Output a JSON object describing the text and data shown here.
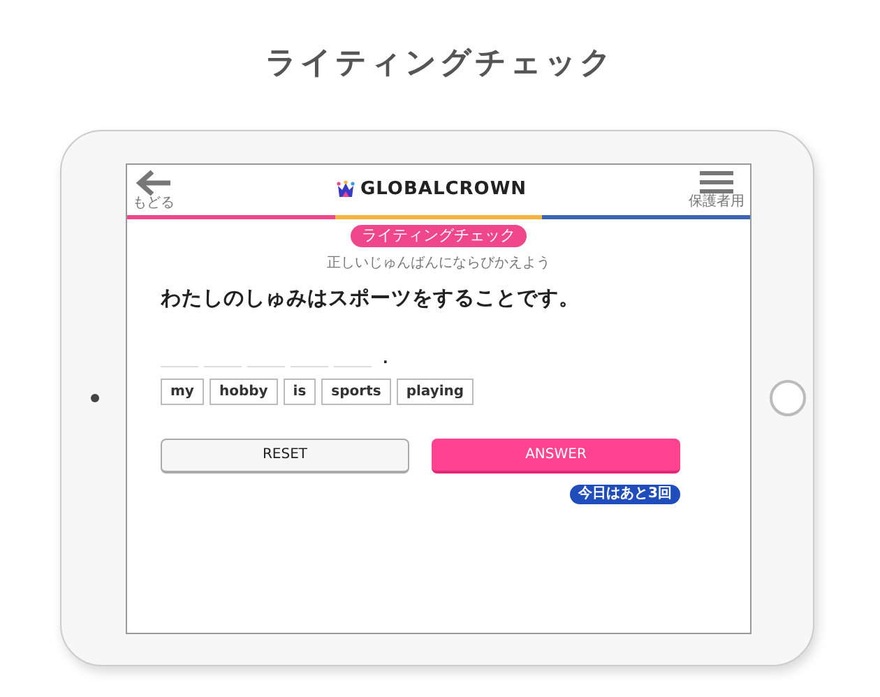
{
  "page_title": "ライティングチェック",
  "app_header": {
    "back_label": "もどる",
    "logo_text": "GLOBALCROWN",
    "menu_label": "保護者用"
  },
  "mode_badge": "ライティングチェック",
  "instruction": "正しいじゅんばんにならびかえよう",
  "sentence": "わたしのしゅみはスポーツをすることです。",
  "answer_slots": [
    {
      "kind": "blank"
    },
    {
      "kind": "blank"
    },
    {
      "kind": "blank"
    },
    {
      "kind": "blank"
    },
    {
      "kind": "blank"
    }
  ],
  "answer_end": ".",
  "word_tiles": [
    {
      "label": "my"
    },
    {
      "label": "hobby"
    },
    {
      "label": "is"
    },
    {
      "label": "sports"
    },
    {
      "label": "playing"
    }
  ],
  "buttons": [
    {
      "label": "RESET",
      "kind": "secondary"
    },
    {
      "label": "ANSWER",
      "kind": "primary"
    }
  ],
  "remaining_badge": "今日はあと3回"
}
